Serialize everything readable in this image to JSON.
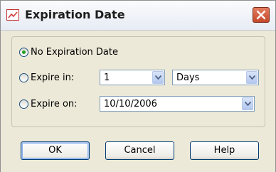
{
  "window": {
    "title": "Expiration Date"
  },
  "options": {
    "no_expiration": {
      "label": "No Expiration Date",
      "selected": true
    },
    "expire_in": {
      "label": "Expire in:",
      "selected": false,
      "amount": "1",
      "unit": "Days"
    },
    "expire_on": {
      "label": "Expire on:",
      "selected": false,
      "date": "10/10/2006"
    }
  },
  "buttons": {
    "ok": "OK",
    "cancel": "Cancel",
    "help": "Help"
  },
  "colors": {
    "radio_selected": "#21a121",
    "close_button": "#c5492b",
    "accent_border": "#003c74"
  },
  "icons": {
    "title": "chart-icon",
    "close": "close-icon",
    "dropdown": "chevron-down-icon"
  }
}
